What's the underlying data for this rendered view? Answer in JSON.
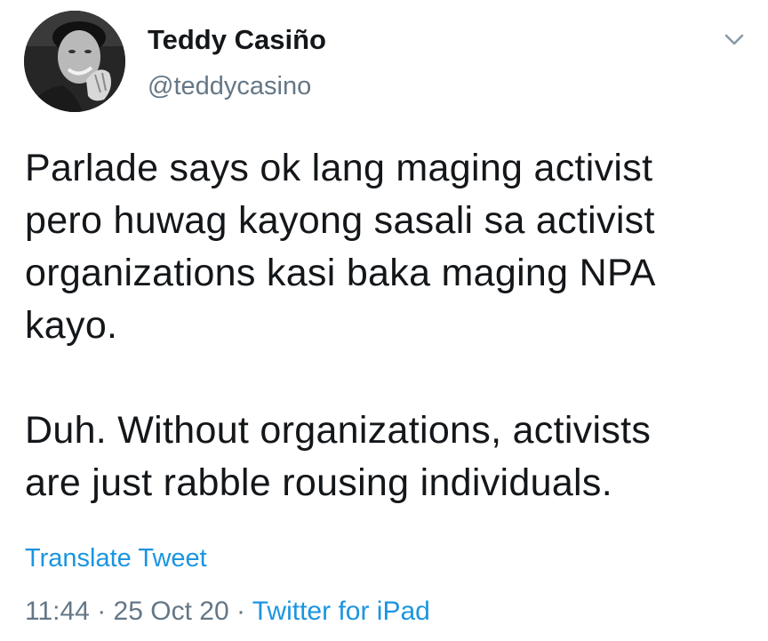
{
  "author": {
    "display_name": "Teddy Casiño",
    "handle": "@teddycasino"
  },
  "tweet": {
    "paragraphs": [
      "Parlade says ok lang maging activist\npero huwag kayong sasali sa activist\norganizations kasi baka maging NPA\nkayo.",
      "Duh. Without organizations, activists\nare just rabble rousing individuals."
    ],
    "translate_label": "Translate Tweet",
    "time": "11:44",
    "date": "25 Oct 20",
    "separator": "·",
    "source": "Twitter for iPad"
  },
  "icons": {
    "menu": "chevron-down-icon",
    "avatar": "profile-photo"
  },
  "colors": {
    "text": "#14171a",
    "secondary": "#657786",
    "link": "#1b95e0"
  }
}
